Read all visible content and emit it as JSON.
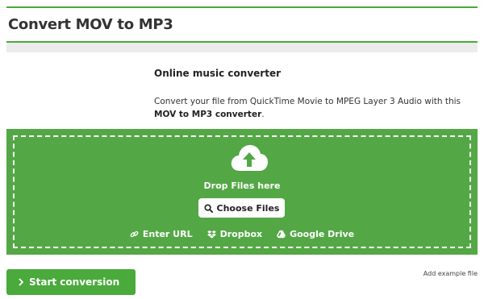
{
  "header": {
    "title": "Convert MOV to MP3"
  },
  "intro": {
    "subheading": "Online music converter",
    "desc_pre": "Convert your file from QuickTime Movie to MPEG Layer 3 Audio with this ",
    "desc_bold": "MOV to MP3 converter",
    "desc_post": "."
  },
  "dropzone": {
    "drop_text": "Drop Files here",
    "choose_label": "Choose Files",
    "sources": [
      {
        "label": "Enter URL",
        "icon": "link-icon"
      },
      {
        "label": "Dropbox",
        "icon": "dropbox-icon"
      },
      {
        "label": "Google Drive",
        "icon": "google-drive-icon"
      }
    ]
  },
  "footer": {
    "start_label": "Start conversion",
    "example_label": "Add example file"
  },
  "colors": {
    "accent": "#4aaa3b",
    "dropzone_bg": "#53a845",
    "gray_bar": "#ececec"
  }
}
